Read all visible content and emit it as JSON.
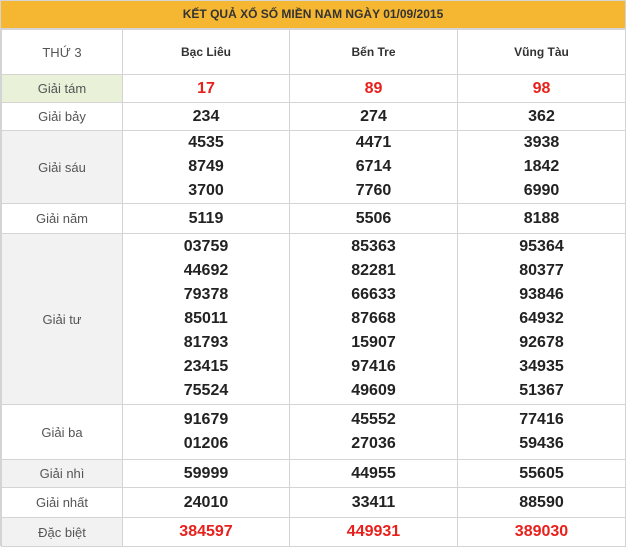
{
  "title": "KẾT QUẢ XỔ SỐ MIỀN NAM NGÀY 01/09/2015",
  "header": {
    "day": "THỨ 3",
    "provinces": [
      "Bạc Liêu",
      "Bến Tre",
      "Vũng Tàu"
    ]
  },
  "rows": [
    {
      "label": "Giải tám",
      "values": [
        [
          "17"
        ],
        [
          "89"
        ],
        [
          "98"
        ]
      ]
    },
    {
      "label": "Giải bảy",
      "values": [
        [
          "234"
        ],
        [
          "274"
        ],
        [
          "362"
        ]
      ]
    },
    {
      "label": "Giải sáu",
      "values": [
        [
          "4535",
          "8749",
          "3700"
        ],
        [
          "4471",
          "6714",
          "7760"
        ],
        [
          "3938",
          "1842",
          "6990"
        ]
      ]
    },
    {
      "label": "Giải năm",
      "values": [
        [
          "5119"
        ],
        [
          "5506"
        ],
        [
          "8188"
        ]
      ]
    },
    {
      "label": "Giải tư",
      "values": [
        [
          "03759",
          "44692",
          "79378",
          "85011",
          "81793",
          "23415",
          "75524"
        ],
        [
          "85363",
          "82281",
          "66633",
          "87668",
          "15907",
          "97416",
          "49609"
        ],
        [
          "95364",
          "80377",
          "93846",
          "64932",
          "92678",
          "34935",
          "51367"
        ]
      ]
    },
    {
      "label": "Giải ba",
      "values": [
        [
          "91679",
          "01206"
        ],
        [
          "45552",
          "27036"
        ],
        [
          "77416",
          "59436"
        ]
      ]
    },
    {
      "label": "Giải nhì",
      "values": [
        [
          "59999"
        ],
        [
          "44955"
        ],
        [
          "55605"
        ]
      ]
    },
    {
      "label": "Giải nhất",
      "values": [
        [
          "24010"
        ],
        [
          "33411"
        ],
        [
          "88590"
        ]
      ]
    },
    {
      "label": "Đặc biệt",
      "values": [
        [
          "384597"
        ],
        [
          "449931"
        ],
        [
          "389030"
        ]
      ]
    }
  ],
  "colors": {
    "title_bg": "#f5b731",
    "highlight": "#e8201c",
    "first_label_bg": "#e9f1d9"
  }
}
